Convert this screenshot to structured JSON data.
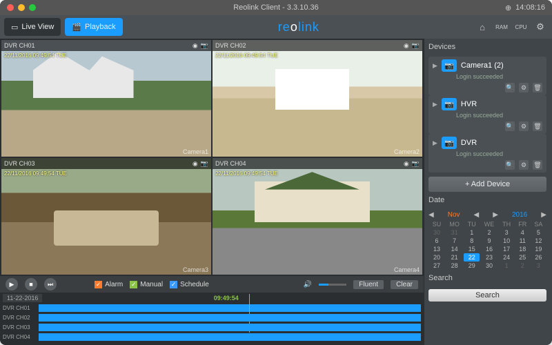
{
  "window": {
    "title": "Reolink Client - 3.3.10.36",
    "clock": "14:08:16"
  },
  "tabs": {
    "live": "Live View",
    "playback": "Playback"
  },
  "brand": {
    "prefix": "re",
    "mid": "o",
    "suffix": "link"
  },
  "toolbar_icons": [
    "inbox-icon",
    "ram-icon",
    "cpu-icon",
    "gear-icon"
  ],
  "cameras": [
    {
      "label": "DVR CH01",
      "timestamp": "22/11/2016 09:49:54 TUE",
      "watermark": "Camera1",
      "selected": true
    },
    {
      "label": "DVR CH02",
      "timestamp": "22/11/2016 09:49:54 TUE",
      "watermark": "Camera2",
      "selected": false
    },
    {
      "label": "DVR CH03",
      "timestamp": "22/11/2016 09:49:54 TUE",
      "watermark": "Camera3",
      "selected": false
    },
    {
      "label": "DVR CH04",
      "timestamp": "22/11/2016 09:49:54 TUE",
      "watermark": "Camera4",
      "selected": false
    }
  ],
  "controls": {
    "filters": {
      "alarm": "Alarm",
      "manual": "Manual",
      "schedule": "Schedule"
    },
    "quality": "Fluent",
    "clear": "Clear"
  },
  "timeline": {
    "date": "11-22-2016",
    "playhead": "09:49:54",
    "rows": [
      "DVR CH01",
      "DVR CH02",
      "DVR CH03",
      "DVR CH04"
    ]
  },
  "devices_label": "Devices",
  "devices": [
    {
      "name": "Camera1 (2)",
      "status": "Login succeeded"
    },
    {
      "name": "HVR",
      "status": "Login succeeded"
    },
    {
      "name": "DVR",
      "status": "Login succeeded"
    }
  ],
  "add_device": "+  Add Device",
  "date_label": "Date",
  "calendar": {
    "month": "Nov",
    "year": "2016",
    "dow": [
      "SU",
      "MO",
      "TU",
      "WE",
      "TH",
      "FR",
      "SA"
    ],
    "weeks": [
      [
        {
          "d": 30,
          "dim": true
        },
        {
          "d": 31,
          "dim": true
        },
        {
          "d": 1
        },
        {
          "d": 2
        },
        {
          "d": 3
        },
        {
          "d": 4
        },
        {
          "d": 5
        }
      ],
      [
        {
          "d": 6
        },
        {
          "d": 7
        },
        {
          "d": 8
        },
        {
          "d": 9
        },
        {
          "d": 10
        },
        {
          "d": 11
        },
        {
          "d": 12
        }
      ],
      [
        {
          "d": 13
        },
        {
          "d": 14
        },
        {
          "d": 15
        },
        {
          "d": 16
        },
        {
          "d": 17
        },
        {
          "d": 18
        },
        {
          "d": 19
        }
      ],
      [
        {
          "d": 20
        },
        {
          "d": 21
        },
        {
          "d": 22,
          "today": true
        },
        {
          "d": 23
        },
        {
          "d": 24
        },
        {
          "d": 25
        },
        {
          "d": 26
        }
      ],
      [
        {
          "d": 27
        },
        {
          "d": 28
        },
        {
          "d": 29
        },
        {
          "d": 30
        },
        {
          "d": 1,
          "dim": true
        },
        {
          "d": 2,
          "dim": true
        },
        {
          "d": 3,
          "dim": true
        }
      ]
    ]
  },
  "search_label": "Search",
  "search_button": "Search"
}
